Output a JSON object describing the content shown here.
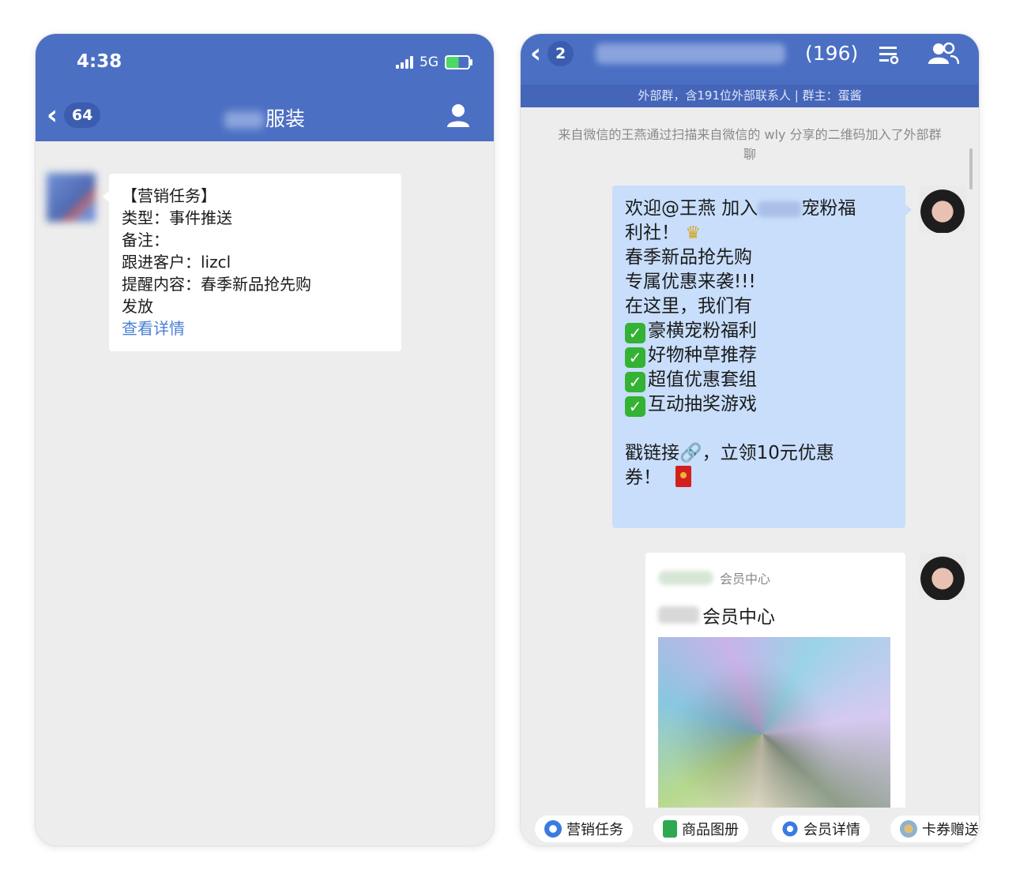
{
  "left": {
    "status": {
      "time": "4:38",
      "network": "5G"
    },
    "header": {
      "back_count": "64",
      "title": "服装"
    },
    "card": {
      "lines": [
        "【营销任务】",
        "类型：事件推送",
        "备注：",
        "跟进客户：lizcl",
        "提醒内容：春季新品抢先购",
        "发放"
      ],
      "link": "查看详情"
    }
  },
  "right": {
    "header": {
      "back_count": "2",
      "member_count": "(196)",
      "subtitle": "外部群，含191位外部联系人 | 群主：蛋酱"
    },
    "system_note": "来自微信的王燕通过扫描来自微信的 wly 分享的二维码加入了外部群聊",
    "bubble": {
      "line1_pre": "欢迎@王燕 加入",
      "line1_post": "宠粉福",
      "line2": "利社！",
      "line3": "春季新品抢先购",
      "line4": "专属优惠来袭!!!",
      "line5": "在这里，我们有",
      "checks": [
        "豪横宠粉福利",
        "好物种草推荐",
        "超值优惠套组",
        "互动抽奖游戏"
      ],
      "cta1": "戳链接🔗，立领10元优惠",
      "cta2": "券！"
    },
    "mini_program": {
      "source": "会员中心",
      "title": "会员中心"
    },
    "toolbar": [
      "营销任务",
      "商品图册",
      "会员详情",
      "卡券赠送"
    ],
    "colors": {
      "header": "#4b6fc3",
      "bubble": "#c8defb"
    }
  }
}
